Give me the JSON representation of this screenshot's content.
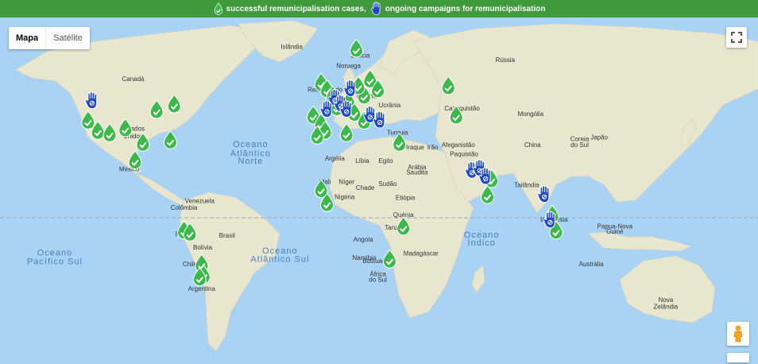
{
  "legend": {
    "success_text": "successful remunicipalisation cases,",
    "ongoing_text": "ongoing campaigns for remunicipalisation",
    "success_icon": "green-drop-check-icon",
    "ongoing_icon": "blue-hand-icon"
  },
  "map_type": {
    "map_label": "Mapa",
    "satellite_label": "Satélite",
    "selected": "Mapa"
  },
  "controls": {
    "fullscreen_icon": "fullscreen-icon",
    "streetview_icon": "pegman-icon"
  },
  "colors": {
    "success": "#3cb94a",
    "ongoing": "#1f49c7",
    "legend_bar": "#3e9a3a",
    "water": "#a9d3f5",
    "land": "#e9e6cf"
  },
  "country_labels": [
    {
      "text": "Islândia",
      "lon": -19,
      "lat": 65
    },
    {
      "text": "Suécia",
      "lon": 16,
      "lat": 63
    },
    {
      "text": "Noruega",
      "lon": 10,
      "lat": 60.5
    },
    {
      "text": "Rússia",
      "lon": 90,
      "lat": 62
    },
    {
      "text": "Canadá",
      "lon": -100,
      "lat": 57
    },
    {
      "text": "Reino Unido",
      "lon": -2,
      "lat": 54
    },
    {
      "text": "Polónia",
      "lon": 19.5,
      "lat": 52
    },
    {
      "text": "Ucrânia",
      "lon": 31,
      "lat": 49
    },
    {
      "text": "Cazaquistão",
      "lon": 68,
      "lat": 48
    },
    {
      "text": "Mongólia",
      "lon": 103,
      "lat": 46
    },
    {
      "text": "Estados",
      "lon": -100,
      "lat": 40.5
    },
    {
      "text": "Unidos",
      "lon": -100,
      "lat": 37.5
    },
    {
      "text": "China",
      "lon": 104,
      "lat": 34
    },
    {
      "text": "Coreia",
      "lon": 128,
      "lat": 36.5
    },
    {
      "text": "do Sul",
      "lon": 128,
      "lat": 34
    },
    {
      "text": "Japão",
      "lon": 138,
      "lat": 37
    },
    {
      "text": "Turquia",
      "lon": 35,
      "lat": 39
    },
    {
      "text": "Iraque",
      "lon": 44,
      "lat": 33
    },
    {
      "text": "Irão",
      "lon": 53,
      "lat": 33
    },
    {
      "text": "Afeganistão",
      "lon": 66,
      "lat": 34
    },
    {
      "text": "Paquistão",
      "lon": 69,
      "lat": 30
    },
    {
      "text": "Argélia",
      "lon": 3,
      "lat": 28
    },
    {
      "text": "Líbia",
      "lon": 17,
      "lat": 27
    },
    {
      "text": "Egito",
      "lon": 29,
      "lat": 27
    },
    {
      "text": "Arábia",
      "lon": 45,
      "lat": 24
    },
    {
      "text": "Saudita",
      "lon": 45,
      "lat": 21.5
    },
    {
      "text": "México",
      "lon": -102,
      "lat": 23
    },
    {
      "text": "Tailândia",
      "lon": 101,
      "lat": 15.5
    },
    {
      "text": "Mali",
      "lon": -2,
      "lat": 17
    },
    {
      "text": "Níger",
      "lon": 9,
      "lat": 17
    },
    {
      "text": "Chade",
      "lon": 18.5,
      "lat": 14
    },
    {
      "text": "Sudão",
      "lon": 30,
      "lat": 16
    },
    {
      "text": "Nigéria",
      "lon": 8,
      "lat": 9.5
    },
    {
      "text": "Etiópia",
      "lon": 39,
      "lat": 9
    },
    {
      "text": "Venezuela",
      "lon": -66,
      "lat": 7.5
    },
    {
      "text": "Colômbia",
      "lon": -74,
      "lat": 4
    },
    {
      "text": "Quénia",
      "lon": 38,
      "lat": 0.5
    },
    {
      "text": "Tanzânia",
      "lon": 35,
      "lat": -6
    },
    {
      "text": "Indonésia",
      "lon": 115,
      "lat": -2
    },
    {
      "text": "Papua-Nova",
      "lon": 146,
      "lat": -5.5
    },
    {
      "text": "Guiné",
      "lon": 146,
      "lat": -8
    },
    {
      "text": "Brasil",
      "lon": -52,
      "lat": -10
    },
    {
      "text": "Peru",
      "lon": -75,
      "lat": -9.5
    },
    {
      "text": "Bolívia",
      "lon": -64.5,
      "lat": -16
    },
    {
      "text": "Angola",
      "lon": 17.5,
      "lat": -12
    },
    {
      "text": "Namíbia",
      "lon": 18,
      "lat": -21
    },
    {
      "text": "Madagáscar",
      "lon": 47,
      "lat": -19
    },
    {
      "text": "Botsuana",
      "lon": 24,
      "lat": -22.5
    },
    {
      "text": "Chile",
      "lon": -71,
      "lat": -24
    },
    {
      "text": "Austrália",
      "lon": 134,
      "lat": -24
    },
    {
      "text": "África",
      "lon": 25,
      "lat": -28.5
    },
    {
      "text": "do Sul",
      "lon": 25,
      "lat": -31
    },
    {
      "text": "Argentina",
      "lon": -65,
      "lat": -35
    },
    {
      "text": "Nova",
      "lon": 172,
      "lat": -39.5
    },
    {
      "text": "Zelândia",
      "lon": 172,
      "lat": -42
    }
  ],
  "ocean_labels": [
    {
      "text": "Oceano",
      "lon": -40,
      "lat": 34
    },
    {
      "text": "Atlântico",
      "lon": -40,
      "lat": 30
    },
    {
      "text": "Norte",
      "lon": -40,
      "lat": 26.5
    },
    {
      "text": "Oceano",
      "lon": -140,
      "lat": -19
    },
    {
      "text": "Pacífico Sul",
      "lon": -140,
      "lat": -23
    },
    {
      "text": "Oceano",
      "lon": -25,
      "lat": -18
    },
    {
      "text": "Atlântico Sul",
      "lon": -25,
      "lat": -22
    },
    {
      "text": "Oceano",
      "lon": 78,
      "lat": -10
    },
    {
      "text": "Índico",
      "lon": 78,
      "lat": -14
    }
  ],
  "markers_success": [
    {
      "lon": -123,
      "lat": 41
    },
    {
      "lon": -118,
      "lat": 37
    },
    {
      "lon": -112,
      "lat": 36
    },
    {
      "lon": -104,
      "lat": 38
    },
    {
      "lon": -88,
      "lat": 45
    },
    {
      "lon": -79,
      "lat": 47
    },
    {
      "lon": -95,
      "lat": 32
    },
    {
      "lon": -81,
      "lat": 33
    },
    {
      "lon": -99,
      "lat": 24
    },
    {
      "lon": -4,
      "lat": 54
    },
    {
      "lon": -1,
      "lat": 52
    },
    {
      "lon": 2,
      "lat": 50
    },
    {
      "lon": 4,
      "lat": 46
    },
    {
      "lon": 7,
      "lat": 47
    },
    {
      "lon": 10,
      "lat": 48
    },
    {
      "lon": -8,
      "lat": 43
    },
    {
      "lon": -4,
      "lat": 40
    },
    {
      "lon": -2,
      "lat": 37
    },
    {
      "lon": -6,
      "lat": 35
    },
    {
      "lon": 13,
      "lat": 44
    },
    {
      "lon": 18,
      "lat": 50
    },
    {
      "lon": 15,
      "lat": 53
    },
    {
      "lon": 14,
      "lat": 63
    },
    {
      "lon": 21,
      "lat": 55
    },
    {
      "lon": 25,
      "lat": 52
    },
    {
      "lon": 18,
      "lat": 41
    },
    {
      "lon": 9,
      "lat": 36
    },
    {
      "lon": 36,
      "lat": 32
    },
    {
      "lon": 61,
      "lat": 53
    },
    {
      "lon": 65,
      "lat": 43
    },
    {
      "lon": -4,
      "lat": 10
    },
    {
      "lon": -1,
      "lat": 3
    },
    {
      "lon": 83,
      "lat": 15
    },
    {
      "lon": 81,
      "lat": 7
    },
    {
      "lon": 38,
      "lat": -9
    },
    {
      "lon": 31,
      "lat": -25
    },
    {
      "lon": 114,
      "lat": -3
    },
    {
      "lon": 116,
      "lat": -11
    },
    {
      "lon": -74,
      "lat": -11
    },
    {
      "lon": -71,
      "lat": -12
    },
    {
      "lon": -65,
      "lat": -27
    },
    {
      "lon": -64,
      "lat": -32
    },
    {
      "lon": -66,
      "lat": -33
    }
  ],
  "markers_ongoing": [
    {
      "lon": -121,
      "lat": 48
    },
    {
      "lon": 3,
      "lat": 49
    },
    {
      "lon": 6,
      "lat": 47
    },
    {
      "lon": 9,
      "lat": 45
    },
    {
      "lon": -1,
      "lat": 45
    },
    {
      "lon": 11,
      "lat": 52
    },
    {
      "lon": 21,
      "lat": 43
    },
    {
      "lon": 26,
      "lat": 41
    },
    {
      "lon": 73,
      "lat": 19
    },
    {
      "lon": 77,
      "lat": 20
    },
    {
      "lon": 80,
      "lat": 16
    },
    {
      "lon": 110,
      "lat": 7
    },
    {
      "lon": 113,
      "lat": -6
    }
  ]
}
